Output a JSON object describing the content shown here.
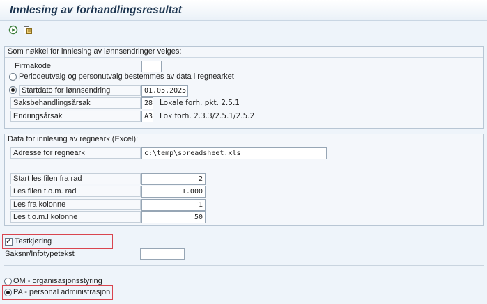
{
  "window": {
    "title": "Innlesing av forhandlingsresultat"
  },
  "toolbar": {
    "execute_icon": "execute-icon",
    "variant_icon": "get-variant-icon"
  },
  "group1": {
    "title": "Som nøkkel for innlesing av lønnsendringer velges:",
    "company_code_label": "Firmakode",
    "company_code_value": "",
    "radio_period_label": "Periodeutvalg og personutvalg bestemmes av data i regnearket",
    "radio_start_label": "Startdato for lønnsendring",
    "start_date_value": "01.05.2025",
    "reason_label": "Saksbehandlingsårsak",
    "reason_value": "28",
    "reason_text": "Lokale forh. pkt. 2.5.1",
    "change_reason_label": "Endringsårsak",
    "change_reason_value": "A3",
    "change_reason_text": "Lok forh. 2.3.3/2.5.1/2.5.2"
  },
  "group2": {
    "title": "Data for innlesing av regneark (Excel):",
    "address_label": "Adresse for regneark",
    "address_value": "c:\\temp\\spreadsheet.xls",
    "start_row_label": "Start les filen fra rad",
    "start_row_value": "2",
    "end_row_label": "Les filen t.o.m. rad",
    "end_row_value": "1.000",
    "from_col_label": "Les fra kolonne",
    "from_col_value": "1",
    "to_col_label": "Les t.o.m.l kolonne",
    "to_col_value": "50"
  },
  "options": {
    "test_run_label": "Testkjøring",
    "test_run_checked": true,
    "case_label": "Saksnr/Infotypetekst",
    "case_value": "",
    "radio_om_label": "OM - organisasjonsstyring",
    "radio_pa_label": "PA - personal administrasjon",
    "selected_mode": "PA"
  },
  "colors": {
    "highlight": "#d9454f",
    "title": "#1d3550"
  }
}
